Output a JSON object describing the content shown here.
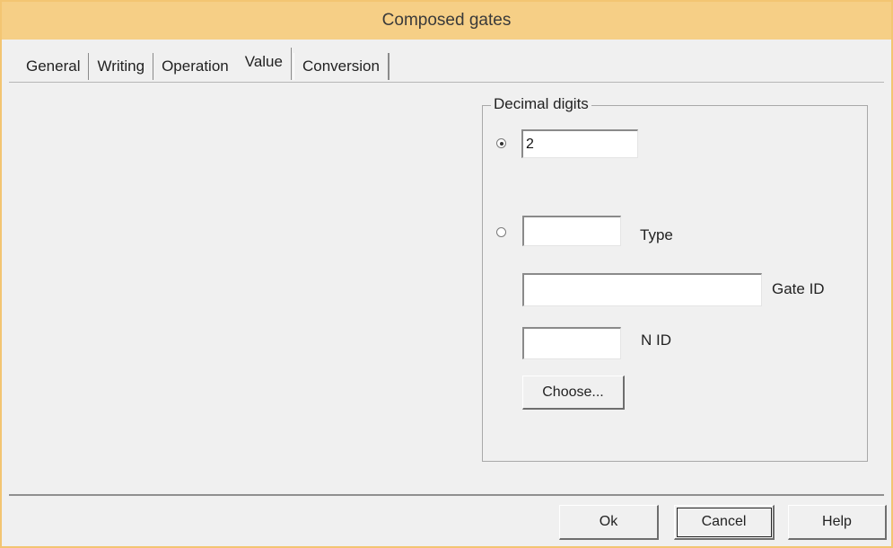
{
  "window": {
    "title": "Composed gates"
  },
  "tabs": [
    {
      "label": "General"
    },
    {
      "label": "Writing"
    },
    {
      "label": "Operation"
    },
    {
      "label": "Value",
      "active": true
    },
    {
      "label": "Conversion"
    }
  ],
  "decimal_group": {
    "title": "Decimal digits",
    "digits_value": "2",
    "digits_selected": true,
    "type_value": "",
    "type_label": "Type",
    "gate_id_value": "",
    "gate_id_label": "Gate ID",
    "nid_value": "",
    "nid_label": "N ID",
    "choose_label": "Choose..."
  },
  "footer": {
    "ok_label": "Ok",
    "cancel_label": "Cancel",
    "help_label": "Help"
  }
}
